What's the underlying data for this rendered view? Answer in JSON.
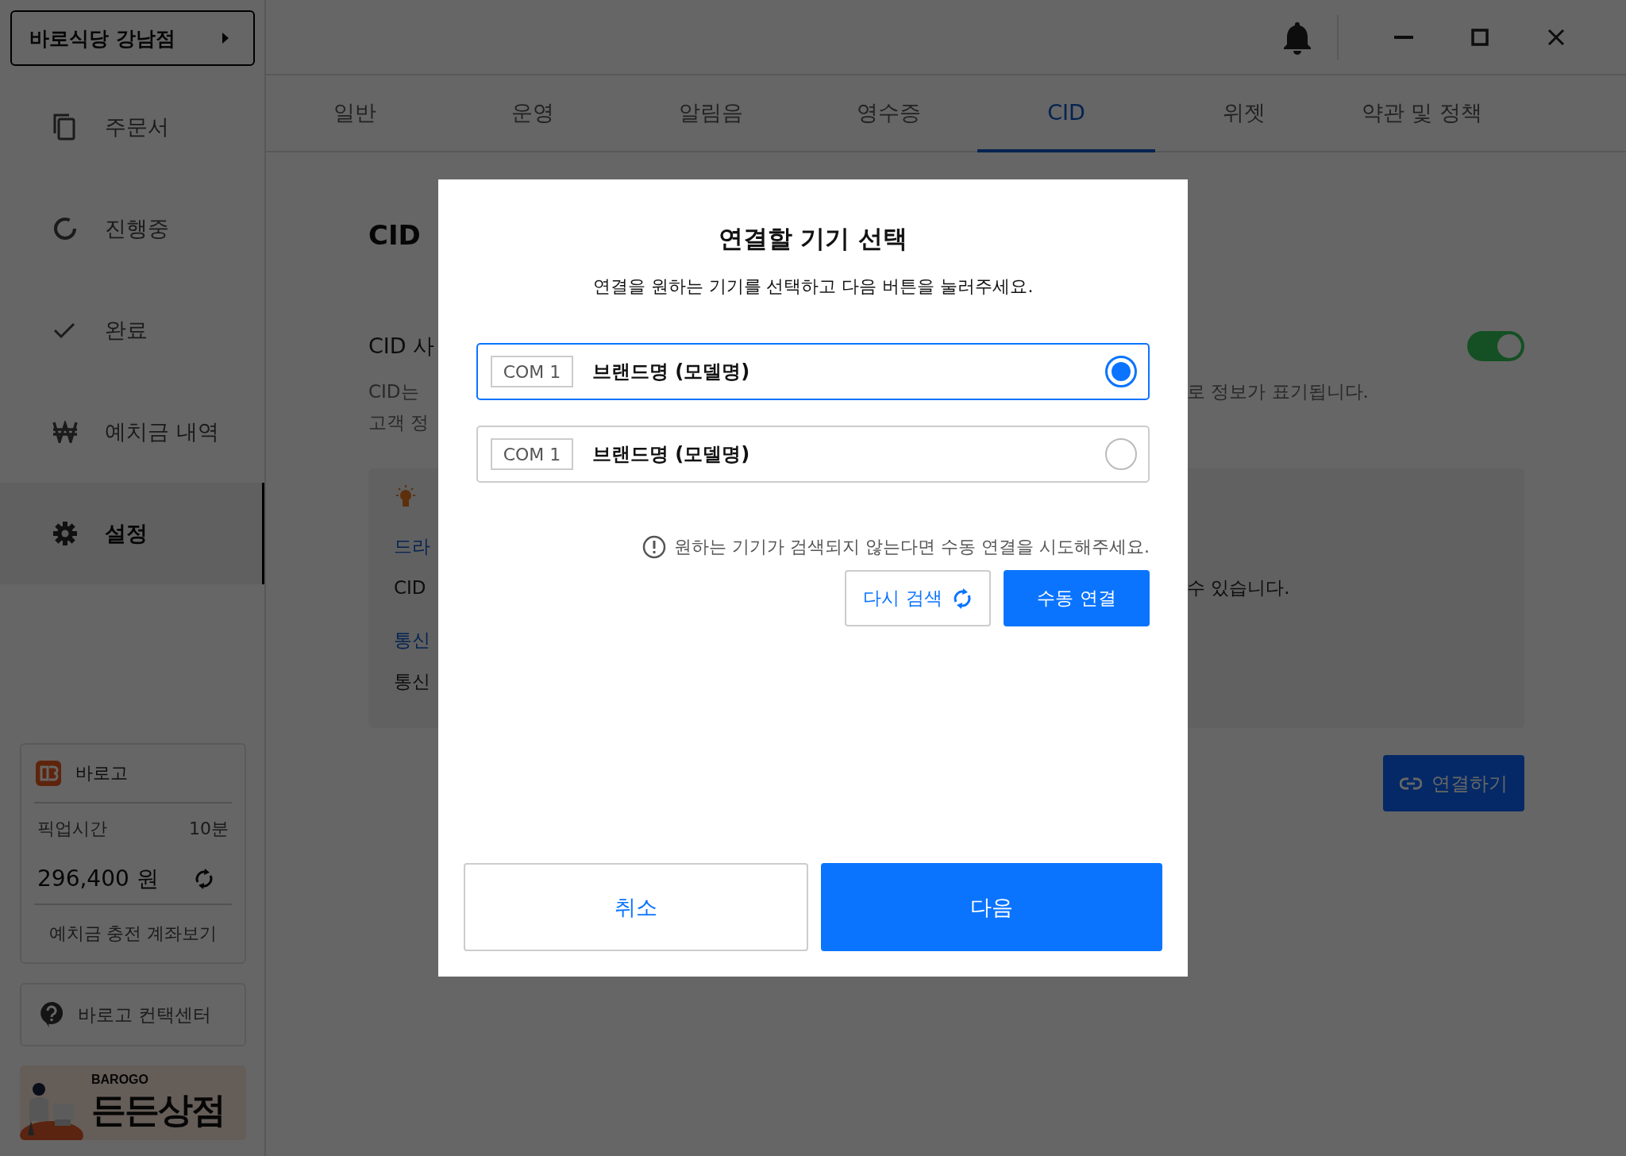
{
  "sidebar": {
    "store_button": "바로식당 강남점",
    "nav": [
      {
        "label": "주문서",
        "selected": false
      },
      {
        "label": "진행중",
        "selected": false
      },
      {
        "label": "완료",
        "selected": false
      },
      {
        "label": "예치금 내역",
        "selected": false
      },
      {
        "label": "설정",
        "selected": true
      }
    ],
    "barogo_card": {
      "title": "바로고",
      "pickup_label": "픽업시간",
      "pickup_value": "10분",
      "balance": "296,400 원",
      "account_link": "예치금 충전 계좌보기"
    },
    "contact_center": "바로고 컨택센터",
    "banner": {
      "brand": "BAROGO",
      "title": "든든상점"
    }
  },
  "tabs": [
    {
      "label": "일반",
      "selected": false
    },
    {
      "label": "운영",
      "selected": false
    },
    {
      "label": "알림음",
      "selected": false
    },
    {
      "label": "영수증",
      "selected": false
    },
    {
      "label": "CID",
      "selected": true
    },
    {
      "label": "위젯",
      "selected": false
    },
    {
      "label": "약관 및 정책",
      "selected": false
    }
  ],
  "content": {
    "title": "CID",
    "usage_label": "CID 사",
    "toggle": {
      "on": true
    },
    "description": [
      {
        "left": "CID는",
        "right": "로 정보가 표기됩니다."
      },
      {
        "left": "고객 정"
      }
    ],
    "info": [
      {
        "kind": "heading",
        "left": "드라"
      },
      {
        "kind": "text",
        "left": "CID",
        "right": "수 있습니다."
      },
      {
        "kind": "heading",
        "left": "통신"
      },
      {
        "kind": "text",
        "left": "통신"
      }
    ],
    "connect_button": "연결하기"
  },
  "dialog": {
    "title": "연결할 기기 선택",
    "subtitle": "연결을 원하는 기기를 선택하고 다음 버튼을 눌러주세요.",
    "devices": [
      {
        "port": "COM 1",
        "name": "브랜드명 (모델명)",
        "selected": true
      },
      {
        "port": "COM 1",
        "name": "브랜드명 (모델명)",
        "selected": false
      }
    ],
    "hint": "원하는 기기가 검색되지 않는다면 수동 연결을 시도해주세요.",
    "rescan_button": "다시 검색",
    "manual_button": "수동 연결",
    "cancel_button": "취소",
    "next_button": "다음"
  }
}
